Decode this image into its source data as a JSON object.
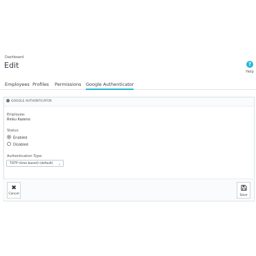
{
  "breadcrumb": "Dashboard",
  "page_title": "Edit",
  "help": {
    "label": "Help",
    "symbol": "?"
  },
  "tabs": [
    {
      "label": "Employees"
    },
    {
      "label": "Profiles"
    },
    {
      "label": "Permissions"
    },
    {
      "label": "Google Authenticator",
      "active": true
    }
  ],
  "card": {
    "header": "GOOGLE AUTHENTICATOR",
    "employee_label": "Employee:",
    "employee_value": "Rinku Kazeno",
    "status_label": "Status:",
    "status_options": [
      {
        "label": "Enabled",
        "checked": true
      },
      {
        "label": "Disabled",
        "checked": false
      }
    ],
    "auth_type_label": "Authentication Type:",
    "auth_type_value": "TOTP (time based) (default)"
  },
  "footer": {
    "cancel_label": "Cancel",
    "save_label": "Save"
  },
  "colors": {
    "accent": "#25b9d7"
  }
}
